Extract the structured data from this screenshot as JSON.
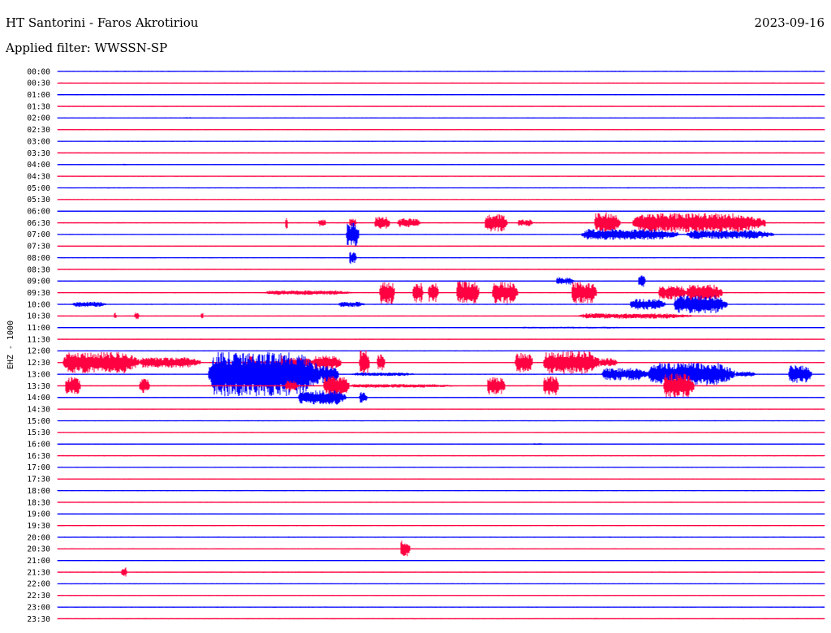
{
  "header": {
    "station": "HT Santorini - Faros Akrotiriou",
    "date": "2023-09-16",
    "filter": "Applied filter: WWSSN-SP"
  },
  "chart_data": {
    "type": "line",
    "title": "HT Santorini - Faros Akrotiriou",
    "subtitle": "Applied filter: WWSSN-SP",
    "ylabel": "EHZ - 1000",
    "xlabel": "",
    "grid": false,
    "legend": "none",
    "rows": [
      "00:00",
      "00:30",
      "01:00",
      "01:30",
      "02:00",
      "02:30",
      "03:00",
      "03:30",
      "04:00",
      "04:30",
      "05:00",
      "05:30",
      "06:00",
      "06:30",
      "07:00",
      "07:30",
      "08:00",
      "08:30",
      "09:00",
      "09:30",
      "10:00",
      "10:30",
      "11:00",
      "11:30",
      "12:00",
      "12:30",
      "13:00",
      "13:30",
      "14:00",
      "14:30",
      "15:00",
      "15:30",
      "16:00",
      "16:30",
      "17:00",
      "17:30",
      "18:00",
      "18:30",
      "19:00",
      "19:30",
      "20:00",
      "20:30",
      "21:00",
      "21:30",
      "22:00",
      "22:30",
      "23:00",
      "23:30"
    ],
    "trace_colors": [
      "#0000ff",
      "#ff0040"
    ],
    "x_range_minutes": [
      0,
      30
    ],
    "bursts": [
      {
        "row": 4,
        "from": 4.9,
        "to": 5.3,
        "amp": 0.1
      },
      {
        "row": 8,
        "from": 2.5,
        "to": 2.7,
        "amp": 0.1
      },
      {
        "row": 13,
        "from": 8.9,
        "to": 9.0,
        "amp": 0.9
      },
      {
        "row": 13,
        "from": 10.2,
        "to": 10.5,
        "amp": 0.4
      },
      {
        "row": 13,
        "from": 11.4,
        "to": 11.7,
        "amp": 0.5
      },
      {
        "row": 13,
        "from": 12.4,
        "to": 13.0,
        "amp": 0.7
      },
      {
        "row": 13,
        "from": 13.3,
        "to": 14.2,
        "amp": 0.5
      },
      {
        "row": 13,
        "from": 16.7,
        "to": 17.6,
        "amp": 1.0
      },
      {
        "row": 13,
        "from": 18.0,
        "to": 18.6,
        "amp": 0.4
      },
      {
        "row": 13,
        "from": 21.0,
        "to": 22.0,
        "amp": 1.2
      },
      {
        "row": 13,
        "from": 22.5,
        "to": 27.7,
        "amp": 1.1
      },
      {
        "row": 14,
        "from": 11.3,
        "to": 11.8,
        "amp": 1.4
      },
      {
        "row": 14,
        "from": 20.5,
        "to": 24.3,
        "amp": 0.6
      },
      {
        "row": 14,
        "from": 24.6,
        "to": 28.0,
        "amp": 0.5
      },
      {
        "row": 16,
        "from": 11.4,
        "to": 11.7,
        "amp": 0.7
      },
      {
        "row": 18,
        "from": 19.5,
        "to": 20.2,
        "amp": 0.4
      },
      {
        "row": 18,
        "from": 22.7,
        "to": 23.0,
        "amp": 0.8
      },
      {
        "row": 19,
        "from": 8.1,
        "to": 11.5,
        "amp": 0.25
      },
      {
        "row": 19,
        "from": 12.6,
        "to": 13.2,
        "amp": 1.3
      },
      {
        "row": 19,
        "from": 13.9,
        "to": 14.3,
        "amp": 1.1
      },
      {
        "row": 19,
        "from": 14.5,
        "to": 14.9,
        "amp": 1.1
      },
      {
        "row": 19,
        "from": 15.6,
        "to": 16.5,
        "amp": 1.3
      },
      {
        "row": 19,
        "from": 17.0,
        "to": 18.0,
        "amp": 1.2
      },
      {
        "row": 19,
        "from": 20.1,
        "to": 21.1,
        "amp": 1.2
      },
      {
        "row": 19,
        "from": 23.5,
        "to": 24.6,
        "amp": 0.8
      },
      {
        "row": 19,
        "from": 24.6,
        "to": 26.0,
        "amp": 0.9
      },
      {
        "row": 20,
        "from": 0.6,
        "to": 1.9,
        "amp": 0.3
      },
      {
        "row": 20,
        "from": 11.0,
        "to": 12.0,
        "amp": 0.3
      },
      {
        "row": 20,
        "from": 22.4,
        "to": 23.8,
        "amp": 0.6
      },
      {
        "row": 20,
        "from": 24.1,
        "to": 26.2,
        "amp": 1.0
      },
      {
        "row": 21,
        "from": 2.2,
        "to": 2.3,
        "amp": 0.4
      },
      {
        "row": 21,
        "from": 3.0,
        "to": 3.2,
        "amp": 0.4
      },
      {
        "row": 21,
        "from": 5.6,
        "to": 5.7,
        "amp": 0.5
      },
      {
        "row": 21,
        "from": 20.4,
        "to": 24.8,
        "amp": 0.3
      },
      {
        "row": 22,
        "from": 18.0,
        "to": 22.5,
        "amp": 0.1
      },
      {
        "row": 25,
        "from": 0.2,
        "to": 3.2,
        "amp": 1.2
      },
      {
        "row": 25,
        "from": 3.2,
        "to": 5.6,
        "amp": 0.6
      },
      {
        "row": 25,
        "from": 7.5,
        "to": 7.7,
        "amp": 0.9
      },
      {
        "row": 25,
        "from": 8.7,
        "to": 8.9,
        "amp": 1.0
      },
      {
        "row": 25,
        "from": 7.0,
        "to": 10.5,
        "amp": 0.15
      },
      {
        "row": 25,
        "from": 8.9,
        "to": 10.0,
        "amp": 0.6
      },
      {
        "row": 25,
        "from": 10.0,
        "to": 11.1,
        "amp": 0.8
      },
      {
        "row": 25,
        "from": 11.8,
        "to": 12.2,
        "amp": 1.4
      },
      {
        "row": 25,
        "from": 12.5,
        "to": 12.8,
        "amp": 1.0
      },
      {
        "row": 25,
        "from": 17.9,
        "to": 18.6,
        "amp": 1.1
      },
      {
        "row": 25,
        "from": 19.0,
        "to": 21.2,
        "amp": 1.3
      },
      {
        "row": 25,
        "from": 21.2,
        "to": 21.9,
        "amp": 0.5
      },
      {
        "row": 26,
        "from": 5.9,
        "to": 10.3,
        "amp": 2.5
      },
      {
        "row": 26,
        "from": 10.3,
        "to": 11.0,
        "amp": 1.0
      },
      {
        "row": 26,
        "from": 11.5,
        "to": 14.0,
        "amp": 0.2
      },
      {
        "row": 26,
        "from": 21.3,
        "to": 23.1,
        "amp": 0.7
      },
      {
        "row": 26,
        "from": 23.1,
        "to": 26.5,
        "amp": 1.3
      },
      {
        "row": 26,
        "from": 26.5,
        "to": 27.3,
        "amp": 0.3
      },
      {
        "row": 26,
        "from": 28.6,
        "to": 29.5,
        "amp": 1.0
      },
      {
        "row": 27,
        "from": 0.3,
        "to": 0.9,
        "amp": 1.0
      },
      {
        "row": 27,
        "from": 3.2,
        "to": 3.6,
        "amp": 0.8
      },
      {
        "row": 27,
        "from": 8.9,
        "to": 9.4,
        "amp": 0.6
      },
      {
        "row": 27,
        "from": 10.4,
        "to": 11.4,
        "amp": 1.2
      },
      {
        "row": 27,
        "from": 11.4,
        "to": 15.5,
        "amp": 0.2
      },
      {
        "row": 27,
        "from": 16.8,
        "to": 17.5,
        "amp": 1.0
      },
      {
        "row": 27,
        "from": 19.0,
        "to": 19.6,
        "amp": 1.1
      },
      {
        "row": 27,
        "from": 23.7,
        "to": 24.9,
        "amp": 1.4
      },
      {
        "row": 28,
        "from": 9.4,
        "to": 11.3,
        "amp": 0.8
      },
      {
        "row": 28,
        "from": 11.8,
        "to": 12.1,
        "amp": 0.6
      },
      {
        "row": 32,
        "from": 18.6,
        "to": 19.0,
        "amp": 0.1
      },
      {
        "row": 41,
        "from": 13.4,
        "to": 13.8,
        "amp": 1.0
      },
      {
        "row": 43,
        "from": 2.5,
        "to": 2.7,
        "amp": 0.6
      }
    ]
  }
}
